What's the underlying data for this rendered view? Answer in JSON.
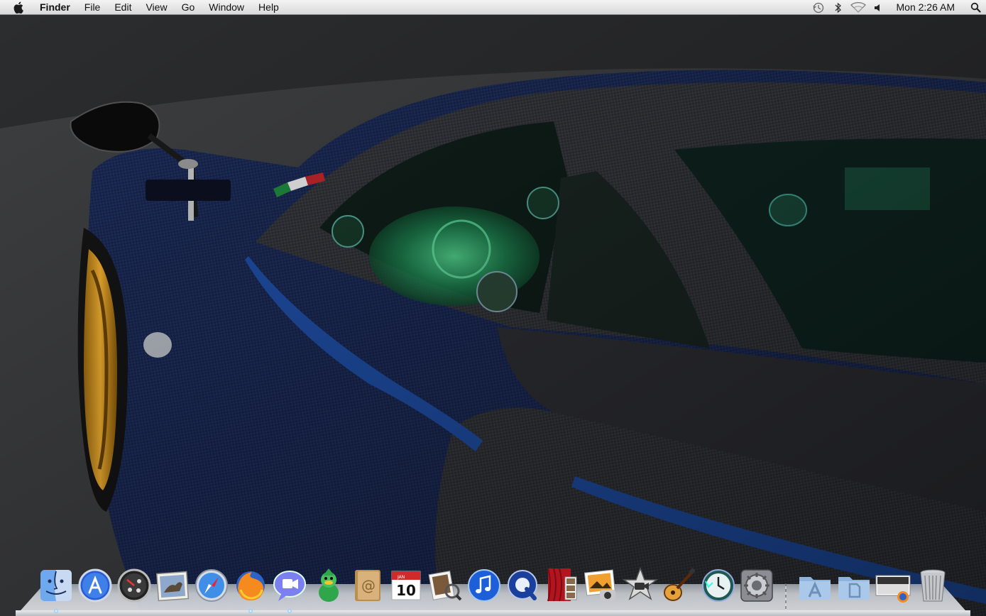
{
  "menubar": {
    "app_name": "Finder",
    "items": [
      "File",
      "Edit",
      "View",
      "Go",
      "Window",
      "Help"
    ],
    "clock": "Mon 2:26 AM",
    "status_icons": [
      "time-machine-icon",
      "bluetooth-icon",
      "wifi-icon",
      "volume-icon"
    ]
  },
  "desktop": {
    "wallpaper": "carbon-fiber supercar"
  },
  "dock": {
    "apps": [
      {
        "name": "Finder",
        "icon": "finder-icon",
        "running": true
      },
      {
        "name": "App Store",
        "icon": "app-store-icon",
        "running": false
      },
      {
        "name": "Dashboard",
        "icon": "dashboard-icon",
        "running": false
      },
      {
        "name": "Mail",
        "icon": "mail-icon",
        "running": false
      },
      {
        "name": "Safari",
        "icon": "safari-icon",
        "running": false
      },
      {
        "name": "Firefox",
        "icon": "firefox-icon",
        "running": true
      },
      {
        "name": "iChat",
        "icon": "ichat-icon",
        "running": true
      },
      {
        "name": "Adium",
        "icon": "adium-icon",
        "running": false
      },
      {
        "name": "Address Book",
        "icon": "address-book-icon",
        "running": false
      },
      {
        "name": "iCal",
        "icon": "ical-icon",
        "running": false
      },
      {
        "name": "Preview",
        "icon": "preview-icon",
        "running": false
      },
      {
        "name": "iTunes",
        "icon": "itunes-icon",
        "running": false
      },
      {
        "name": "QuickTime Player",
        "icon": "quicktime-icon",
        "running": false
      },
      {
        "name": "Photo Booth",
        "icon": "photo-booth-icon",
        "running": false
      },
      {
        "name": "iPhoto",
        "icon": "iphoto-icon",
        "running": false
      },
      {
        "name": "iMovie",
        "icon": "imovie-icon",
        "running": false
      },
      {
        "name": "GarageBand",
        "icon": "garageband-icon",
        "running": false
      },
      {
        "name": "Time Machine",
        "icon": "time-machine-dock-icon",
        "running": false
      },
      {
        "name": "System Preferences",
        "icon": "system-preferences-icon",
        "running": false
      },
      {
        "name": "Applications",
        "icon": "applications-folder-icon",
        "running": false
      },
      {
        "name": "Documents",
        "icon": "documents-folder-icon",
        "running": false
      },
      {
        "name": "Downloads",
        "icon": "downloads-stack-icon",
        "running": false
      },
      {
        "name": "Trash",
        "icon": "trash-icon",
        "running": false
      }
    ],
    "ical_month": "JAN",
    "ical_day": "10"
  },
  "colors": {
    "accent_blue": "#1f4fa8",
    "wheel_gold": "#e3a024",
    "dash_green": "#3ee08a"
  }
}
